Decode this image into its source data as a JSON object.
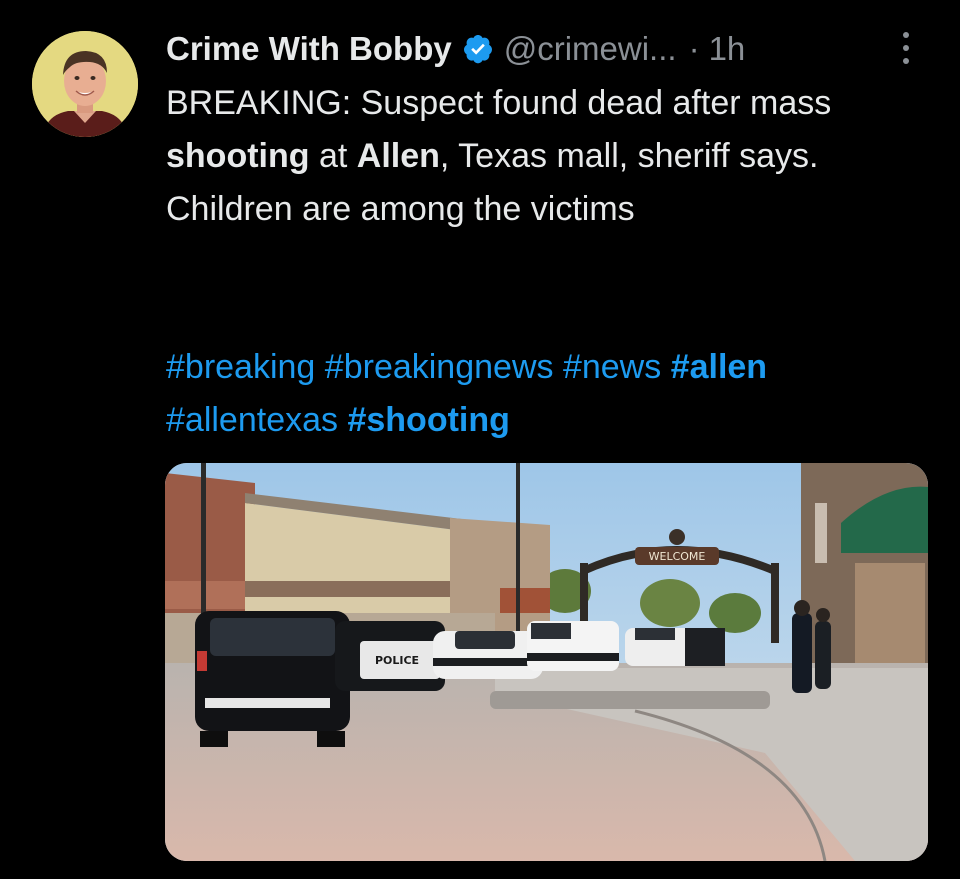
{
  "author": {
    "name": "Crime With Bobby",
    "handle": "@crimewi...",
    "separator": "·",
    "time": "1h",
    "avatar_icon": "profile-photo"
  },
  "tweet": {
    "text_runs": [
      {
        "text": "BREAKING: Suspect found dead after mass ",
        "bold": false
      },
      {
        "text": "shooting",
        "bold": true
      },
      {
        "text": " at ",
        "bold": false
      },
      {
        "text": "Allen",
        "bold": true
      },
      {
        "text": ", Texas mall, sheriff says. Children are among the victims",
        "bold": false
      }
    ],
    "hashtags": [
      {
        "text": "#breaking",
        "bold": false
      },
      {
        "text": "#breakingnews",
        "bold": false
      },
      {
        "text": "#news",
        "bold": false
      },
      {
        "text": "#allen",
        "bold": true
      },
      {
        "text": "#allentexas",
        "bold": false
      },
      {
        "text": "#shooting",
        "bold": true
      }
    ]
  },
  "media": {
    "arch_sign": "WELCOME",
    "vehicle_label": "POLICE"
  },
  "colors": {
    "background": "#000000",
    "text": "#e7e9ea",
    "muted": "#8b9096",
    "link": "#1d9bf0",
    "verified": "#1d9bf0"
  }
}
